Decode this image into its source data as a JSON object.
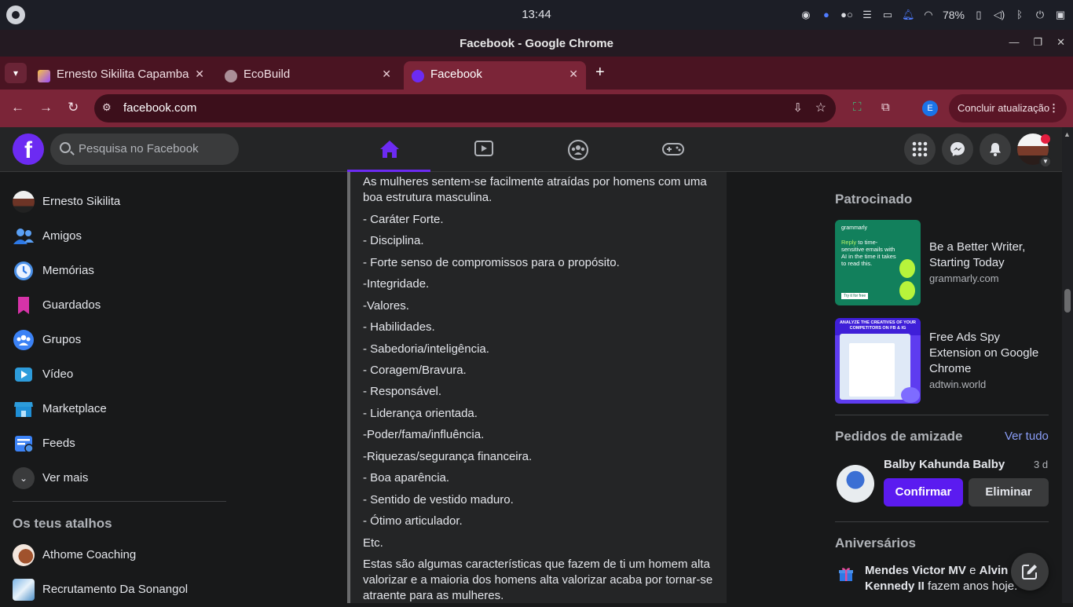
{
  "os": {
    "time": "13:44",
    "battery": "78%",
    "tray_icons": [
      "screen-record-icon",
      "alert-icon",
      "toggle-icon",
      "menu-icon",
      "folder-icon",
      "bell-icon",
      "wifi-icon",
      "battery-icon",
      "volume-icon",
      "bluetooth-icon",
      "power-icon",
      "sidebar-icon"
    ]
  },
  "window": {
    "title": "Facebook - Google Chrome",
    "minimize": "—",
    "restore": "❐",
    "close": "✕"
  },
  "tabs": [
    {
      "label": "Ernesto Sikilita Capamba",
      "close": "✕"
    },
    {
      "label": "EcoBuild",
      "close": "✕"
    },
    {
      "label": "Facebook",
      "close": "✕"
    }
  ],
  "toolbar": {
    "url": "facebook.com",
    "profile_initial": "E",
    "update_label": "Concluir atualização"
  },
  "fb_header": {
    "logo": "f",
    "search_placeholder": "Pesquisa no Facebook"
  },
  "left_nav": [
    {
      "label": "Ernesto Sikilita",
      "icon": "profile-avatar"
    },
    {
      "label": "Amigos",
      "icon": "friends-icon"
    },
    {
      "label": "Memórias",
      "icon": "memories-icon"
    },
    {
      "label": "Guardados",
      "icon": "saved-icon"
    },
    {
      "label": "Grupos",
      "icon": "groups-icon"
    },
    {
      "label": "Vídeo",
      "icon": "video-icon"
    },
    {
      "label": "Marketplace",
      "icon": "marketplace-icon"
    },
    {
      "label": "Feeds",
      "icon": "feeds-icon"
    },
    {
      "label": "Ver mais",
      "icon": "chevron-down-icon"
    }
  ],
  "shortcuts": {
    "heading": "Os teus atalhos",
    "items": [
      {
        "label": "Athome Coaching"
      },
      {
        "label": "Recrutamento Da Sonangol"
      }
    ]
  },
  "post": {
    "lines": [
      "As mulheres sentem-se facilmente atraídas por homens com uma boa estrutura masculina.",
      "- Caráter Forte.",
      "- Disciplina.",
      "- Forte senso de compromissos para o propósito.",
      "-Integridade.",
      "-Valores.",
      "- Habilidades.",
      "- Sabedoria/inteligência.",
      "- Coragem/Bravura.",
      "- Responsável.",
      "- Liderança orientada.",
      "-Poder/fama/influência.",
      "-Riquezas/segurança financeira.",
      "- Boa aparência.",
      "- Sentido de vestido maduro.",
      "- Ótimo articulador.",
      "Etc.",
      "Estas são algumas características que fazem de ti um homem alta valorizar e a maioria dos homens alta valorizar acaba por tornar-se atraente para as mulheres."
    ]
  },
  "sponsored": {
    "heading": "Patrocinado",
    "ads": [
      {
        "title": "Be a Better Writer, Starting Today",
        "domain": "grammarly.com",
        "thumb_brand": "grammarly",
        "thumb_lead": "Reply",
        "thumb_body": "to time-sensitive emails with AI in the time it takes to read this.",
        "thumb_cta": "Try it for free"
      },
      {
        "title": "Free Ads Spy Extension on Google Chrome",
        "domain": "adtwin.world",
        "thumb_headline": "ANALYZE THE CREATIVES OF YOUR COMPETITORS ON FB & IG"
      }
    ]
  },
  "friend_requests": {
    "heading": "Pedidos de amizade",
    "see_all": "Ver tudo",
    "name": "Balby Kahunda Balby",
    "age": "3 d",
    "confirm": "Confirmar",
    "delete": "Eliminar"
  },
  "birthdays": {
    "heading": "Aniversários",
    "name1": "Mendes Victor MV",
    "conj": " e ",
    "name2": "Alvin Kennedy II",
    "rest": " fazem anos hoje."
  },
  "colors": {
    "accent": "#6c2bf2",
    "confirm": "#5b1bf0",
    "tab_bar": "#4a1422",
    "toolbar": "#7b2538"
  }
}
